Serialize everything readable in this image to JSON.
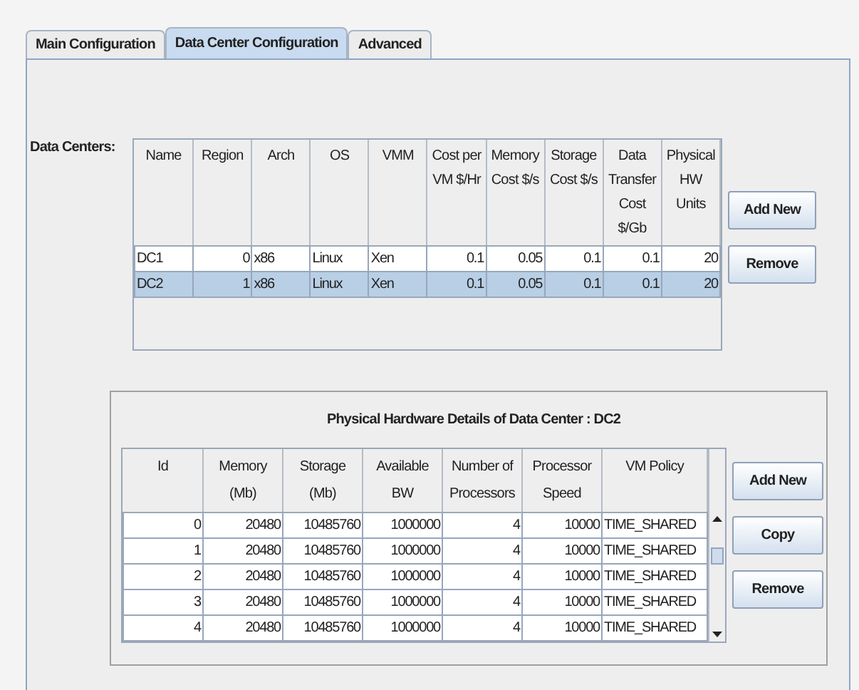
{
  "tabs": [
    {
      "label": "Main Configuration",
      "selected": false
    },
    {
      "label": "Data Center Configuration",
      "selected": true
    },
    {
      "label": "Advanced",
      "selected": false
    }
  ],
  "data_centers": {
    "label": "Data Centers:",
    "columns": [
      {
        "label": "Name",
        "kind": "text"
      },
      {
        "label": "Region",
        "kind": "number"
      },
      {
        "label": "Arch",
        "kind": "text"
      },
      {
        "label": "OS",
        "kind": "text"
      },
      {
        "label": "VMM",
        "kind": "text"
      },
      {
        "label": "Cost per VM $/Hr",
        "kind": "number"
      },
      {
        "label": "Memory Cost $/s",
        "kind": "number"
      },
      {
        "label": "Storage Cost $/s",
        "kind": "number"
      },
      {
        "label": "Data Transfer Cost $/Gb",
        "kind": "number"
      },
      {
        "label": "Physical HW Units",
        "kind": "number"
      }
    ],
    "rows": [
      {
        "selected": false,
        "cells": [
          "DC1",
          "0",
          "x86",
          "Linux",
          "Xen",
          "0.1",
          "0.05",
          "0.1",
          "0.1",
          "20"
        ]
      },
      {
        "selected": true,
        "cells": [
          "DC2",
          "1",
          "x86",
          "Linux",
          "Xen",
          "0.1",
          "0.05",
          "0.1",
          "0.1",
          "20"
        ]
      }
    ],
    "buttons": [
      "Add New",
      "Remove"
    ]
  },
  "hardware": {
    "title": "Physical Hardware Details of Data Center : DC2",
    "columns": [
      {
        "label": "Id",
        "kind": "number"
      },
      {
        "label": "Memory (Mb)",
        "kind": "number"
      },
      {
        "label": "Storage (Mb)",
        "kind": "number"
      },
      {
        "label": "Available BW",
        "kind": "number"
      },
      {
        "label": "Number of Processors",
        "kind": "number"
      },
      {
        "label": "Processor Speed",
        "kind": "number"
      },
      {
        "label": "VM Policy",
        "kind": "text"
      }
    ],
    "rows": [
      {
        "cells": [
          "0",
          "20480",
          "10485760",
          "1000000",
          "4",
          "10000",
          "TIME_SHARED"
        ]
      },
      {
        "cells": [
          "1",
          "20480",
          "10485760",
          "1000000",
          "4",
          "10000",
          "TIME_SHARED"
        ]
      },
      {
        "cells": [
          "2",
          "20480",
          "10485760",
          "1000000",
          "4",
          "10000",
          "TIME_SHARED"
        ]
      },
      {
        "cells": [
          "3",
          "20480",
          "10485760",
          "1000000",
          "4",
          "10000",
          "TIME_SHARED"
        ]
      },
      {
        "cells": [
          "4",
          "20480",
          "10485760",
          "1000000",
          "4",
          "10000",
          "TIME_SHARED"
        ]
      }
    ],
    "buttons": [
      "Add New",
      "Copy",
      "Remove"
    ]
  }
}
